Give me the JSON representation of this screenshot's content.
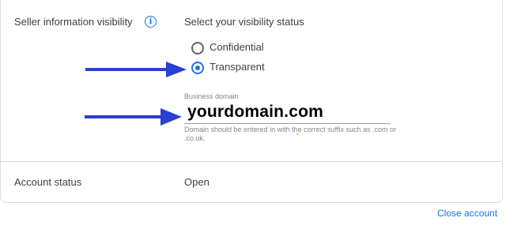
{
  "visibility": {
    "label": "Seller information visibility",
    "info_icon": "info-icon",
    "heading": "Select your visibility status",
    "options": [
      {
        "label": "Confidential",
        "selected": false
      },
      {
        "label": "Transparent",
        "selected": true
      }
    ],
    "domain_field": {
      "label": "Business domain",
      "value": "yourdomain.com",
      "helper": "Domain should be entered in with the correct suffix such as .com or .co.uk."
    }
  },
  "account_status": {
    "label": "Account status",
    "value": "Open"
  },
  "close_account_link": "Close account",
  "colors": {
    "accent": "#1a73e8",
    "annotation_arrow": "#2b3fd0"
  }
}
